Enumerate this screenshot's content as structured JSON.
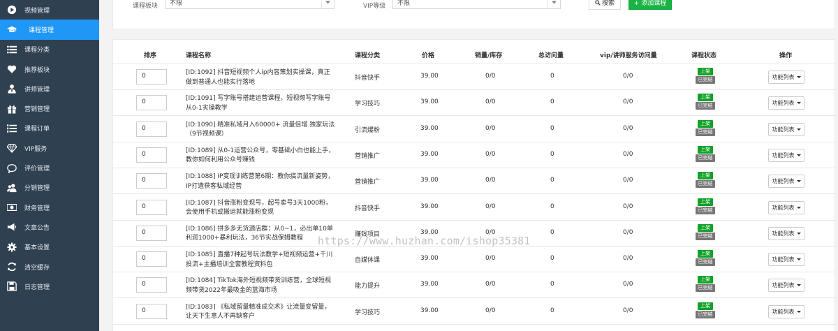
{
  "sidebar": {
    "items": [
      {
        "label": "视频管理",
        "icon": "play-circle-icon",
        "active": false
      },
      {
        "label": "课程管理",
        "icon": "graduation-cap-icon",
        "active": true
      },
      {
        "label": "课程分类",
        "icon": "list-icon",
        "active": false
      },
      {
        "label": "推荐板块",
        "icon": "heart-icon",
        "active": false
      },
      {
        "label": "讲师管理",
        "icon": "user-tie-icon",
        "active": false
      },
      {
        "label": "营销管理",
        "icon": "gift-icon",
        "active": false
      },
      {
        "label": "课程订单",
        "icon": "list-ol-icon",
        "active": false
      },
      {
        "label": "VIP服务",
        "icon": "diamond-icon",
        "active": false
      },
      {
        "label": "评价管理",
        "icon": "comment-icon",
        "active": false
      },
      {
        "label": "分销管理",
        "icon": "users-icon",
        "active": false
      },
      {
        "label": "财务管理",
        "icon": "money-icon",
        "active": false
      },
      {
        "label": "文章公告",
        "icon": "bullhorn-icon",
        "active": false
      },
      {
        "label": "基本设置",
        "icon": "gear-icon",
        "active": false
      },
      {
        "label": "清空缓存",
        "icon": "refresh-icon",
        "active": false
      },
      {
        "label": "日志管理",
        "icon": "save-icon",
        "active": false
      }
    ]
  },
  "filters": {
    "category_label": "课程板块",
    "category_value": "不限",
    "vip_label": "VIP等级",
    "vip_value": "不限",
    "search_label": "搜索",
    "add_label": "+ 添加课程"
  },
  "table": {
    "headers": {
      "sort": "排序",
      "name": "课程名称",
      "category": "课程分类",
      "price": "价格",
      "sales": "销量/库存",
      "visits": "总访问量",
      "vip_visits": "vip/讲师服务访问量",
      "status": "课程状态",
      "actions": "操作"
    },
    "rows": [
      {
        "sort": "0",
        "name": "[ID:1092] 抖音短视频个人ip内容策划实操课，真正做到普通人也能实行落地",
        "category": "抖音快手",
        "price": "39.00",
        "sales": "0/0",
        "visits": "0",
        "vip_visits": "0/0",
        "status_on": "上架",
        "status_done": "已完结",
        "action": "功能列表"
      },
      {
        "sort": "0",
        "name": "[ID:1091] 写字账号搭建运营课程，短视频写字账号从0-1实操教学",
        "category": "学习技巧",
        "price": "39.00",
        "sales": "0/0",
        "visits": "0",
        "vip_visits": "0/0",
        "status_on": "上架",
        "status_done": "已完结",
        "action": "功能列表"
      },
      {
        "sort": "0",
        "name": "[ID:1090] 精准私域月入60000+ 流量倍增 独家玩法（9节视频课）",
        "category": "引流爆粉",
        "price": "39.00",
        "sales": "0/0",
        "visits": "0",
        "vip_visits": "0/0",
        "status_on": "上架",
        "status_done": "已完结",
        "action": "功能列表"
      },
      {
        "sort": "0",
        "name": "[ID:1089] 从0-1运营公众号，零基础小白也能上手，教你如何利用公众号赚钱",
        "category": "营销推广",
        "price": "39.00",
        "sales": "0/0",
        "visits": "0",
        "vip_visits": "0/0",
        "status_on": "上架",
        "status_done": "已完结",
        "action": "功能列表"
      },
      {
        "sort": "0",
        "name": "[ID:1088] IP变现训练营第6期：教你搞流量新姿势，IP打造获客私域经营",
        "category": "营销推广",
        "price": "39.00",
        "sales": "0/0",
        "visits": "0",
        "vip_visits": "0/0",
        "status_on": "上架",
        "status_done": "已完结",
        "action": "功能列表"
      },
      {
        "sort": "0",
        "name": "[ID:1087] 抖音涨粉变现号，起号卖号3天1000粉，会使用手机或搬运就能涨粉变现",
        "category": "抖音快手",
        "price": "39.00",
        "sales": "0/0",
        "visits": "0",
        "vip_visits": "0/0",
        "status_on": "上架",
        "status_done": "已完结",
        "action": "功能列表"
      },
      {
        "sort": "0",
        "name": "[ID:1086] 拼多多无货源店群：从0~1，必出单10单利润1000+暴利玩法，36节实战保姆教程",
        "category": "赚钱项目",
        "price": "39.00",
        "sales": "0/0",
        "visits": "0",
        "vip_visits": "0/0",
        "status_on": "上架",
        "status_done": "已完结",
        "action": "功能列表"
      },
      {
        "sort": "0",
        "name": "[ID:1085] 直播7种起号玩法教学+短视频运营+千川投流+主播培训全套教程资料包",
        "category": "自媒体课",
        "price": "39.00",
        "sales": "0/0",
        "visits": "0",
        "vip_visits": "0/0",
        "status_on": "上架",
        "status_done": "已完结",
        "action": "功能列表"
      },
      {
        "sort": "0",
        "name": "[ID:1084] TikTok海外短视频带货训练营，全球短视频带货2022年最吸金的蓝海市场",
        "category": "能力提升",
        "price": "39.00",
        "sales": "0/0",
        "visits": "0",
        "vip_visits": "0/0",
        "status_on": "上架",
        "status_done": "已完结",
        "action": "功能列表"
      },
      {
        "sort": "0",
        "name": "[ID:1083] 《私域留量精准成交术》让流量变留量，让天下生意人不再缺客户",
        "category": "学习技巧",
        "price": "39.00",
        "sales": "0/0",
        "visits": "0",
        "vip_visits": "0/0",
        "status_on": "上架",
        "status_done": "已完结",
        "action": "功能列表"
      }
    ]
  },
  "watermark": "https://www.huzhan.com/ishop35381",
  "colors": {
    "sidebar_bg": "#2f4050",
    "sidebar_active": "#1e97f7",
    "add_button": "#1ab344",
    "status_on": "#12a229",
    "status_done": "#777777"
  }
}
